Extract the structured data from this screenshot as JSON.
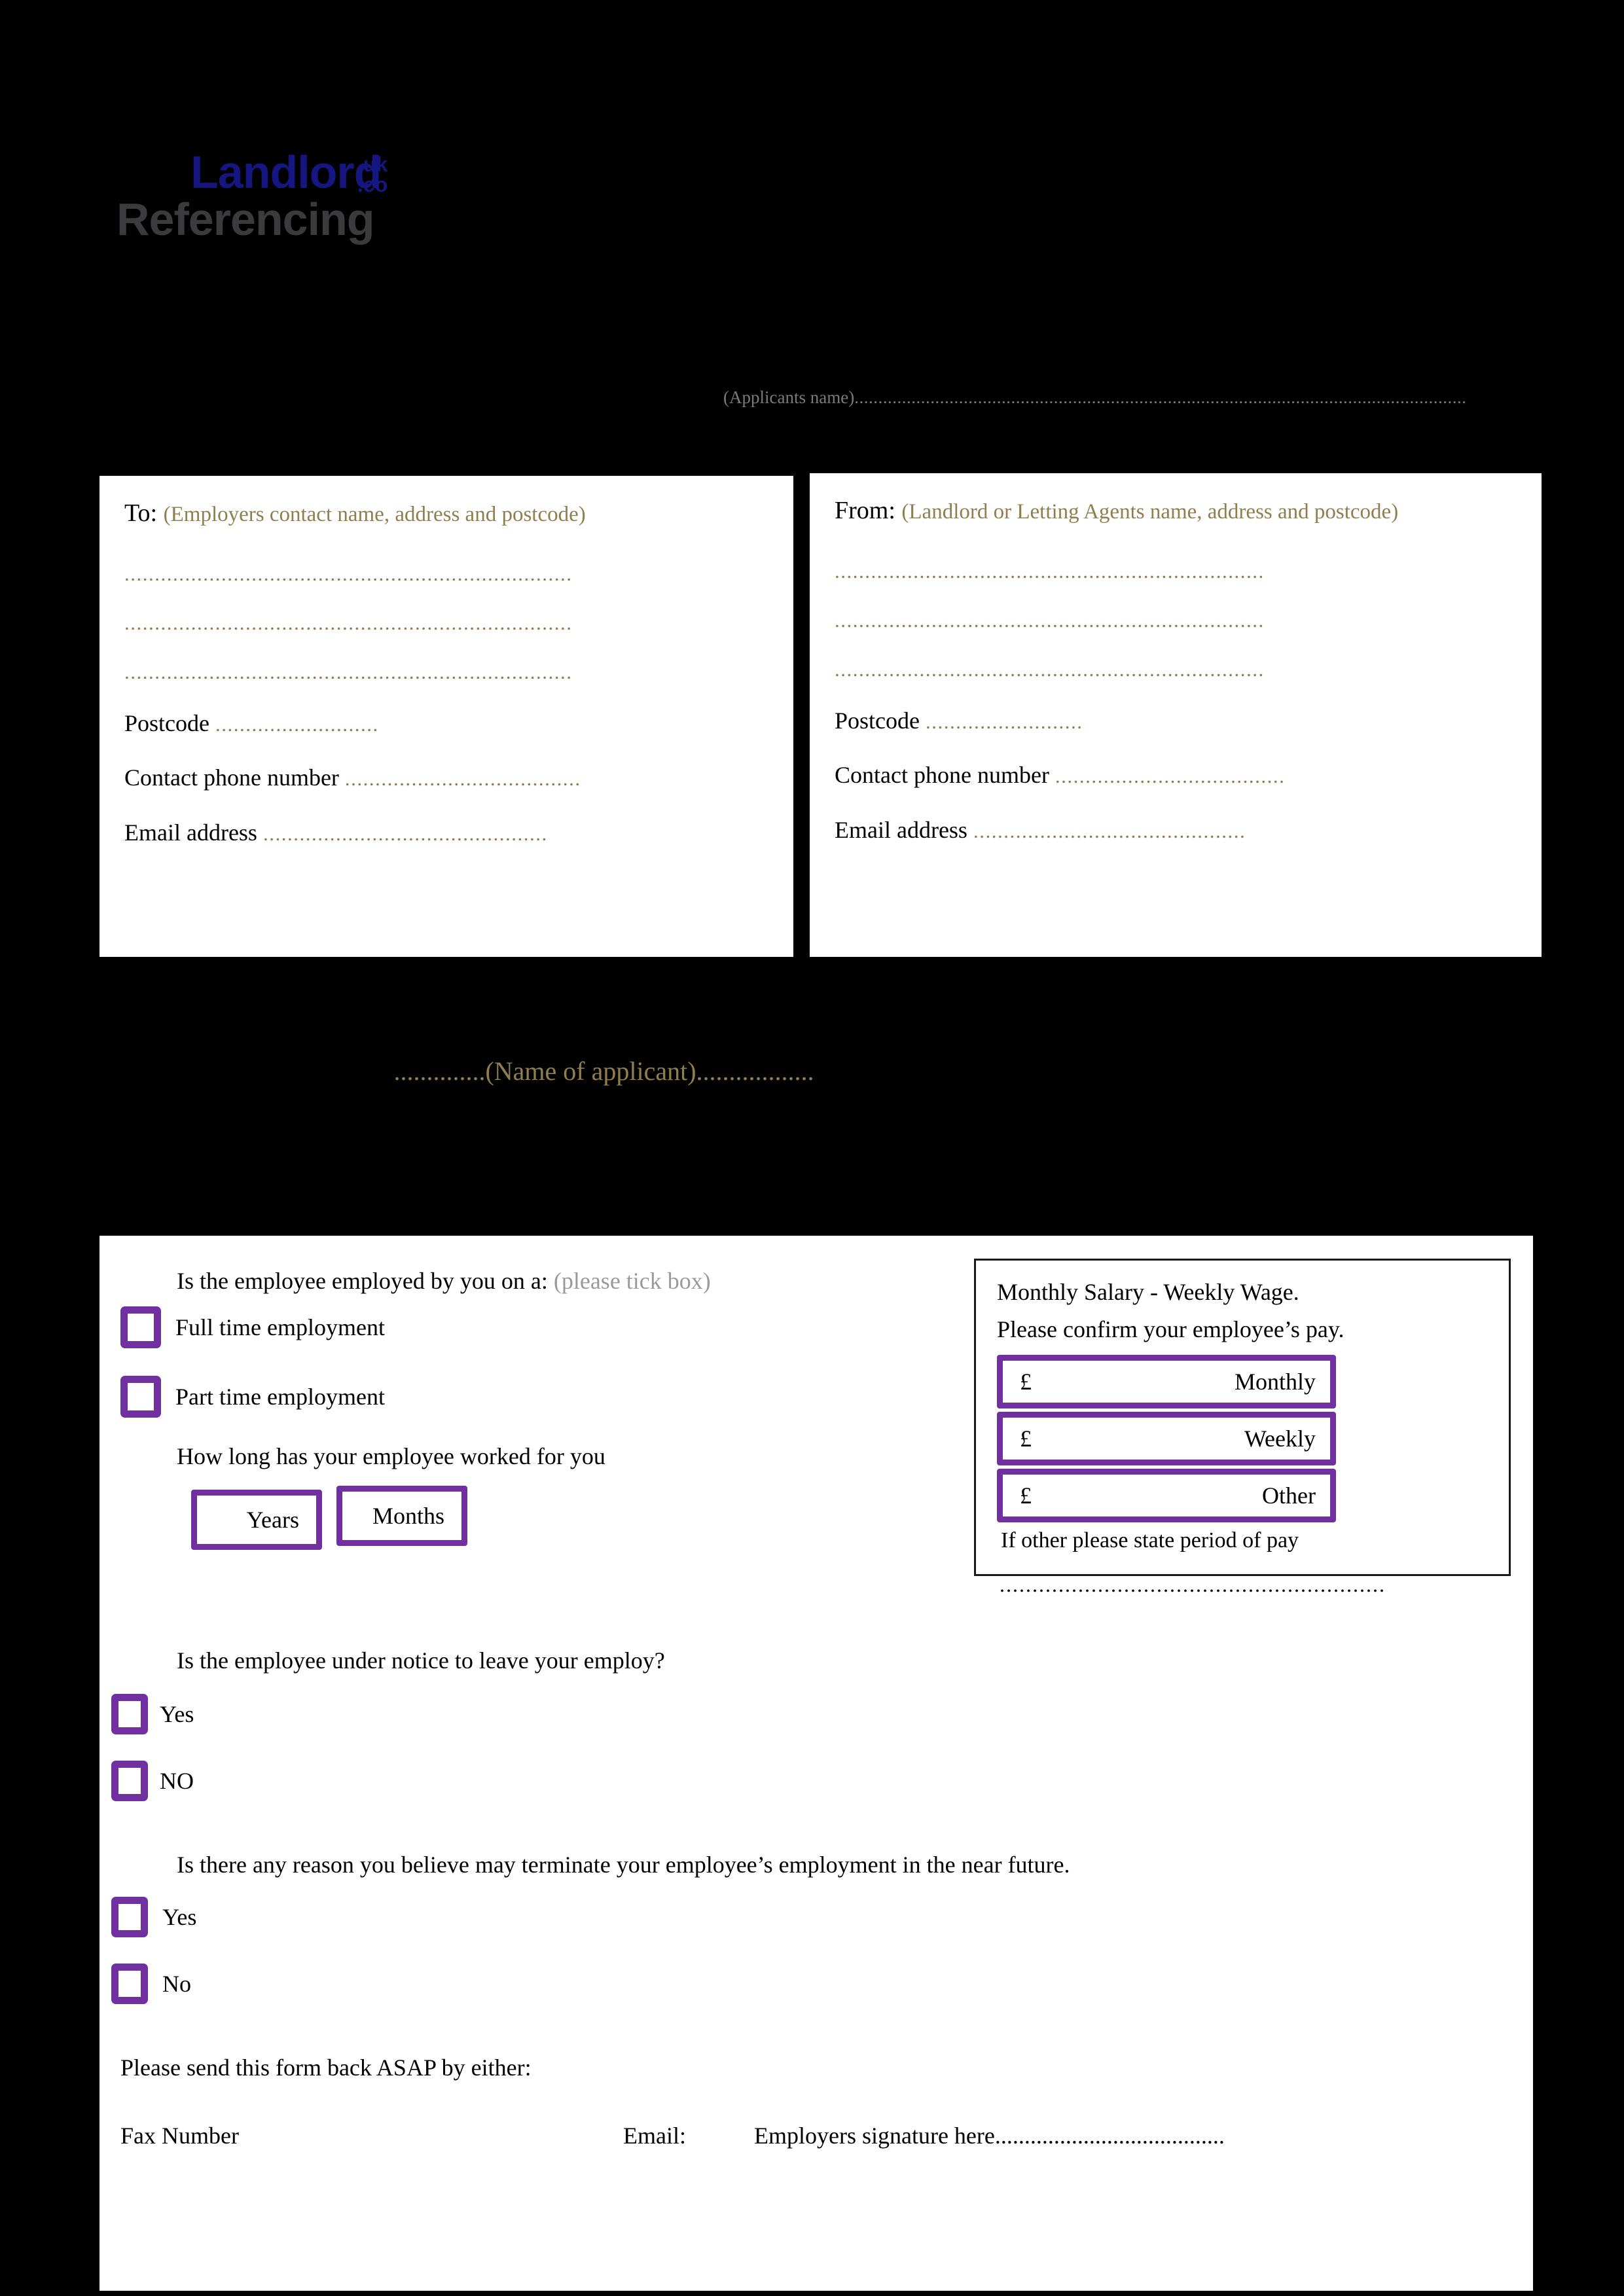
{
  "logo": {
    "line1": "Landlord",
    "line2": "Referencing",
    "tld_1": ".uk",
    "tld_2": ".co",
    "color_primary": "#161680",
    "color_secondary": "#3b3b3e"
  },
  "header": {
    "applicants_name_label": "(Applicants name)",
    "applicants_name_dots": "................................................................................................................................."
  },
  "to_box": {
    "label": "To:",
    "hint": "(Employers contact name, address and postcode)",
    "address_lines": [
      "..........................................................................",
      "..........................................................................",
      ".........................................................................."
    ],
    "postcode_label": "Postcode",
    "postcode_dots": "...........................",
    "phone_label": "Contact phone number",
    "phone_dots": ".......................................",
    "email_label": "Email address",
    "email_dots": "..............................................."
  },
  "from_box": {
    "label": "From:",
    "hint": "(Landlord or Letting Agents name, address and postcode)",
    "address_lines": [
      ".......................................................................",
      ".......................................................................",
      "......................................................................."
    ],
    "postcode_label": "Postcode",
    "postcode_dots": "..........................",
    "phone_label": "Contact phone number",
    "phone_dots": "......................................",
    "email_label": "Email address",
    "email_dots": "............................................."
  },
  "applicant_line": {
    "prefix_dots": "..............",
    "text": "(Name of applicant)",
    "suffix_dots": ".................."
  },
  "form": {
    "q1": {
      "question": "Is the employee employed by you on a:",
      "hint": "(please tick box)",
      "option_full": "Full time employment",
      "option_part": "Part time employment"
    },
    "q2": {
      "question": "How long has your employee worked for you",
      "years_label": "Years",
      "months_label": "Months"
    },
    "q3": {
      "question": "Is the employee under notice to leave your employ?",
      "option_yes": "Yes",
      "option_no": "NO"
    },
    "q4": {
      "question": "Is there any reason you believe may terminate your employee’s employment in the near future.",
      "option_yes": "Yes",
      "option_no": "No"
    }
  },
  "salary": {
    "title": "Monthly Salary - Weekly Wage.",
    "subtitle": "Please confirm your employee’s pay.",
    "rows": [
      {
        "currency": "£",
        "period": "Monthly"
      },
      {
        "currency": "£",
        "period": "Weekly"
      },
      {
        "currency": "£",
        "period": "Other"
      }
    ],
    "other_note": "If other please state period of pay",
    "other_dots": "..........................................................."
  },
  "footer": {
    "send_back": "Please send this form back ASAP by either:",
    "fax_label": "Fax Number",
    "email_label": "Email:",
    "signature_label": "Employers signature here",
    "signature_dots": "......................................."
  },
  "colors": {
    "accent_purple": "#7030a0",
    "hint_gold": "#8f7f4e",
    "page_background": "#000000",
    "panel_background": "#ffffff"
  }
}
